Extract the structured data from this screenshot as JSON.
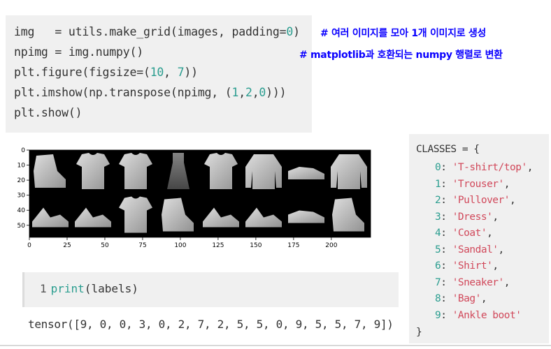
{
  "code_cell": {
    "line1_a": "img   = utils.make_grid(images, padding=",
    "line1_num": "0",
    "line1_b": ")",
    "line2": "npimg = img.numpy()",
    "line3_a": "plt.figure(figsize=(",
    "line3_n1": "10",
    "line3_sep": ", ",
    "line3_n2": "7",
    "line3_b": "))",
    "line4_a": "plt.imshow(np.transpose(npimg, (",
    "line4_n1": "1",
    "line4_c1": ",",
    "line4_n2": "2",
    "line4_c2": ",",
    "line4_n3": "0",
    "line4_b": ")))",
    "line5": "plt.show()"
  },
  "annotations": {
    "comment1": "# 여러 이미지를 모아 1개 이미지로 생성",
    "comment2": "# matplotlib과 호환되는 numpy 행렬로 변환",
    "color": "#0a00ff"
  },
  "plot": {
    "y_ticks": [
      "0",
      "10",
      "20",
      "30",
      "40",
      "50"
    ],
    "x_ticks": [
      "0",
      "25",
      "50",
      "75",
      "100",
      "125",
      "150",
      "175",
      "200"
    ],
    "x_tick_values": [
      0,
      25,
      50,
      75,
      100,
      125,
      150,
      175,
      200
    ],
    "y_tick_values": [
      0,
      10,
      20,
      30,
      40,
      50
    ],
    "xlim": [
      0,
      226
    ],
    "ylim": [
      0,
      58
    ],
    "grid_rows": [
      [
        "ankle-boot",
        "t-shirt",
        "t-shirt",
        "dress",
        "t-shirt",
        "pullover",
        "sneaker",
        "pullover"
      ],
      [
        "sandal",
        "sandal",
        "t-shirt",
        "ankle-boot",
        "sandal",
        "sandal",
        "sneaker",
        "ankle-boot"
      ]
    ]
  },
  "print_cell": {
    "line_number": "1",
    "fn": "print",
    "args": "(labels)"
  },
  "output": {
    "tensor_text": "tensor([9, 0, 0, 3, 0, 2, 7, 2, 5, 5, 0, 9, 5, 5, 7, 9])"
  },
  "classes": {
    "header": "CLASSES = {",
    "footer": "}",
    "entries": [
      {
        "key": "0",
        "value": "'T-shirt/top'",
        "trail": ","
      },
      {
        "key": "1",
        "value": "'Trouser'",
        "trail": ","
      },
      {
        "key": "2",
        "value": "'Pullover'",
        "trail": ","
      },
      {
        "key": "3",
        "value": "'Dress'",
        "trail": ","
      },
      {
        "key": "4",
        "value": "'Coat'",
        "trail": ","
      },
      {
        "key": "5",
        "value": "'Sandal'",
        "trail": ","
      },
      {
        "key": "6",
        "value": "'Shirt'",
        "trail": ","
      },
      {
        "key": "7",
        "value": "'Sneaker'",
        "trail": ","
      },
      {
        "key": "8",
        "value": "'Bag'",
        "trail": ","
      },
      {
        "key": "9",
        "value": "'Ankle boot'",
        "trail": ""
      }
    ]
  }
}
